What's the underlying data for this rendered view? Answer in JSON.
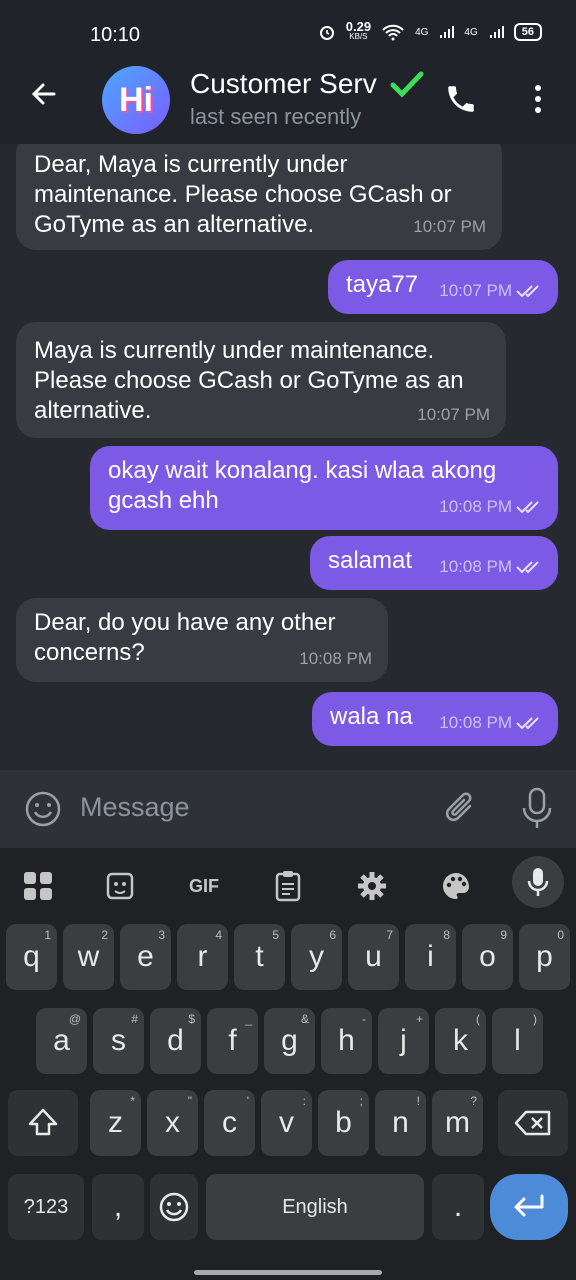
{
  "status": {
    "time": "10:10",
    "speed": "0.29",
    "speed_unit": "KB/S",
    "net1": "4G",
    "net2": "4G",
    "battery": "56"
  },
  "header": {
    "avatar_text": "Hi",
    "title": "Customer Serv",
    "subtitle": "last seen recently"
  },
  "messages": [
    {
      "dir": "in",
      "text": "Dear, Maya is currently under maintenance. Please choose GCash or GoTyme as an alternative.",
      "time": "10:07 PM"
    },
    {
      "dir": "out",
      "text": "taya77",
      "time": "10:07 PM"
    },
    {
      "dir": "in",
      "text": "Maya is currently under maintenance. Please choose GCash or GoTyme as an alternative.",
      "time": "10:07 PM"
    },
    {
      "dir": "out",
      "text": "okay wait konalang. kasi wlaa akong gcash ehh",
      "time": "10:08 PM"
    },
    {
      "dir": "out",
      "text": "salamat",
      "time": "10:08 PM"
    },
    {
      "dir": "in",
      "text": "Dear, do you have any other concerns?",
      "time": "10:08 PM"
    },
    {
      "dir": "out",
      "text": "wala na",
      "time": "10:08 PM"
    }
  ],
  "composer": {
    "placeholder": "Message"
  },
  "keyboard": {
    "gif_label": "GIF",
    "row1": [
      [
        "q",
        "1"
      ],
      [
        "w",
        "2"
      ],
      [
        "e",
        "3"
      ],
      [
        "r",
        "4"
      ],
      [
        "t",
        "5"
      ],
      [
        "y",
        "6"
      ],
      [
        "u",
        "7"
      ],
      [
        "i",
        "8"
      ],
      [
        "o",
        "9"
      ],
      [
        "p",
        "0"
      ]
    ],
    "row2": [
      [
        "a",
        "@"
      ],
      [
        "s",
        "#"
      ],
      [
        "d",
        "$"
      ],
      [
        "f",
        "_"
      ],
      [
        "g",
        "&"
      ],
      [
        "h",
        "-"
      ],
      [
        "j",
        "+"
      ],
      [
        "k",
        "("
      ],
      [
        "l",
        ")"
      ]
    ],
    "row3": [
      [
        "z",
        "*"
      ],
      [
        "x",
        "\""
      ],
      [
        "c",
        "'"
      ],
      [
        "v",
        ":"
      ],
      [
        "b",
        ";"
      ],
      [
        "n",
        "!"
      ],
      [
        "m",
        "?"
      ]
    ],
    "symbols": "?123",
    "comma": ",",
    "space": "English",
    "period": "."
  }
}
